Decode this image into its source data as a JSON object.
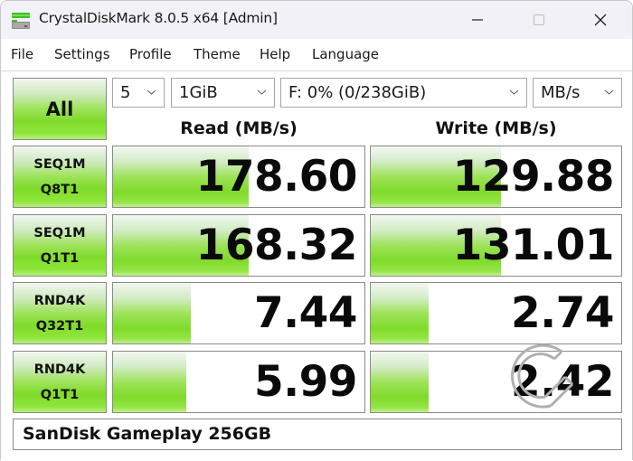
{
  "window": {
    "title": "CrystalDiskMark 8.0.5 x64 [Admin]",
    "app_icon": "crystaldiskmark-drive-icon",
    "controls": [
      "minimize",
      "maximize",
      "close"
    ]
  },
  "menu": {
    "items": [
      "File",
      "Settings",
      "Profile",
      "Theme",
      "Help",
      "Language"
    ]
  },
  "toolbar": {
    "all_button": "All",
    "count_select": "5",
    "size_select": "1GiB",
    "drive_select": "F: 0% (0/238GiB)",
    "unit_select": "MB/s"
  },
  "headers": {
    "read": "Read (MB/s)",
    "write": "Write (MB/s)"
  },
  "tests": [
    {
      "line1": "SEQ1M",
      "line2": "Q8T1",
      "read": "178.60",
      "write": "129.88",
      "read_fill_pct": 54,
      "write_fill_pct": 52
    },
    {
      "line1": "SEQ1M",
      "line2": "Q1T1",
      "read": "168.32",
      "write": "131.01",
      "read_fill_pct": 54,
      "write_fill_pct": 52
    },
    {
      "line1": "RND4K",
      "line2": "Q32T1",
      "read": "7.44",
      "write": "2.74",
      "read_fill_pct": 31,
      "write_fill_pct": 23
    },
    {
      "line1": "RND4K",
      "line2": "Q1T1",
      "read": "5.99",
      "write": "2.42",
      "read_fill_pct": 29,
      "write_fill_pct": 23
    }
  ],
  "drive_name": "SanDisk Gameplay 256GB",
  "colors": {
    "accent_green": "#7fdb2a",
    "border": "#8a8a8a",
    "titlebar_bg": "#f1f1f7"
  }
}
